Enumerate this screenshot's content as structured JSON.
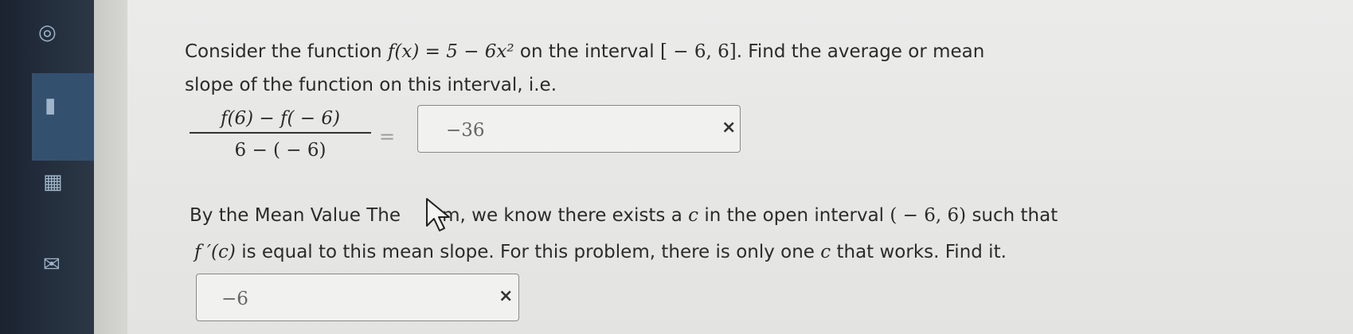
{
  "question": {
    "intro_text": "Consider the function",
    "function_expr": "f(x) = 5 − 6x²",
    "interval_text": "on the interval",
    "interval": "[ − 6, 6]",
    "task_text": ". Find the average or mean",
    "line2": "slope of the function on this interval, i.e.",
    "fraction_numerator": "f(6) − f( − 6)",
    "fraction_denominator": "6 − ( − 6)",
    "equals": "=",
    "answer1": "−36",
    "mvt_line1_a": "By the Mean Value The",
    "mvt_line1_b": "em, we know there exists a",
    "mvt_c": "c",
    "mvt_line1_c": "in the open interval",
    "open_interval": "( − 6, 6)",
    "mvt_line1_d": "such that",
    "fprime_c": "f ′(c)",
    "mvt_line2_a": "is equal to this mean slope. For this problem, there is only one",
    "mvt_line2_b": "that works. Find it.",
    "answer2": "−6",
    "clear_symbol": "×"
  },
  "icons": {
    "sidebar": [
      "globe-icon",
      "book-icon",
      "calendar-icon",
      "mail-icon"
    ],
    "field": "clear-icon",
    "pointer": "mouse-cursor-icon"
  },
  "colors": {
    "sidebar": "#1b2230",
    "sidebar_active": "#34506f",
    "page": "#e6e6e4"
  }
}
